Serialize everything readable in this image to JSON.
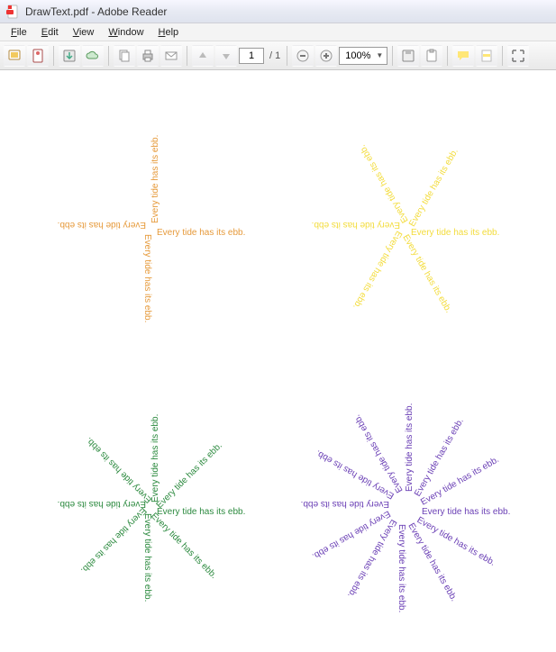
{
  "window": {
    "title": "DrawText.pdf - Adobe Reader"
  },
  "menu": {
    "file": "File",
    "edit": "Edit",
    "view": "View",
    "window": "Window",
    "help": "Help"
  },
  "toolbar": {
    "page_current": "1",
    "page_total": "/ 1",
    "zoom": "100%"
  },
  "document": {
    "text": "Every tide has its ebb.",
    "patterns": [
      {
        "id": "p1",
        "color": "c-orange",
        "rays": 4,
        "offset_deg": 0,
        "color_hex": "#e69a3b"
      },
      {
        "id": "p2",
        "color": "c-yellow",
        "rays": 6,
        "offset_deg": 0,
        "color_hex": "#f3dc3c"
      },
      {
        "id": "p3",
        "color": "c-green",
        "rays": 8,
        "offset_deg": 0,
        "color_hex": "#2c8a3f"
      },
      {
        "id": "p4",
        "color": "c-purple",
        "rays": 12,
        "offset_deg": 0,
        "color_hex": "#6a3fb5"
      }
    ]
  }
}
